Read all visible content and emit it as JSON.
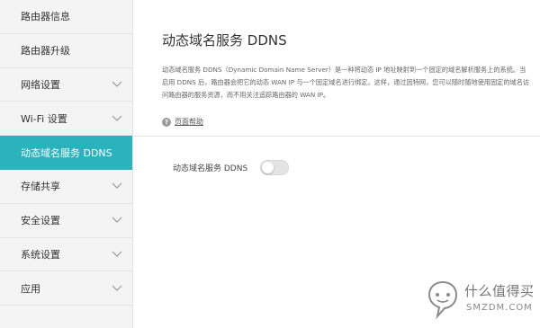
{
  "sidebar": {
    "items": [
      {
        "label": "路由器信息",
        "active": false,
        "has_chevron": false
      },
      {
        "label": "路由器升级",
        "active": false,
        "has_chevron": false
      },
      {
        "label": "网络设置",
        "active": false,
        "has_chevron": true
      },
      {
        "label": "Wi-Fi 设置",
        "active": false,
        "has_chevron": true
      },
      {
        "label": "动态域名服务 DDNS",
        "active": true,
        "has_chevron": false
      },
      {
        "label": "存储共享",
        "active": false,
        "has_chevron": true
      },
      {
        "label": "安全设置",
        "active": false,
        "has_chevron": true
      },
      {
        "label": "系统设置",
        "active": false,
        "has_chevron": true
      },
      {
        "label": "应用",
        "active": false,
        "has_chevron": true
      }
    ]
  },
  "main": {
    "title": "动态域名服务 DDNS",
    "description": "动态域名服务 DDNS（Dynamic Domain Name Server）是一种将动态 IP 地址映射到一个固定的域名解析服务上的系统。当启用 DDNS 后，路由器会把它的动态 WAN IP 与一个固定域名进行绑定。这样，通过因特网，您可以随时随地使用固定的域名访问路由器的服务资源，而不用关注追踪路由器的 WAN IP。",
    "help_icon_glyph": "?",
    "help_label": "页面帮助",
    "ddns_label": "动态域名服务 DDNS",
    "ddns_enabled": false
  },
  "watermark": {
    "text_cn": "什么值得买",
    "text_en": "SMZDM.COM"
  },
  "colors": {
    "accent": "#2ab3bd",
    "sidebar_bg": "#f4f4f4",
    "toggle_off": "#e4e4e4"
  }
}
